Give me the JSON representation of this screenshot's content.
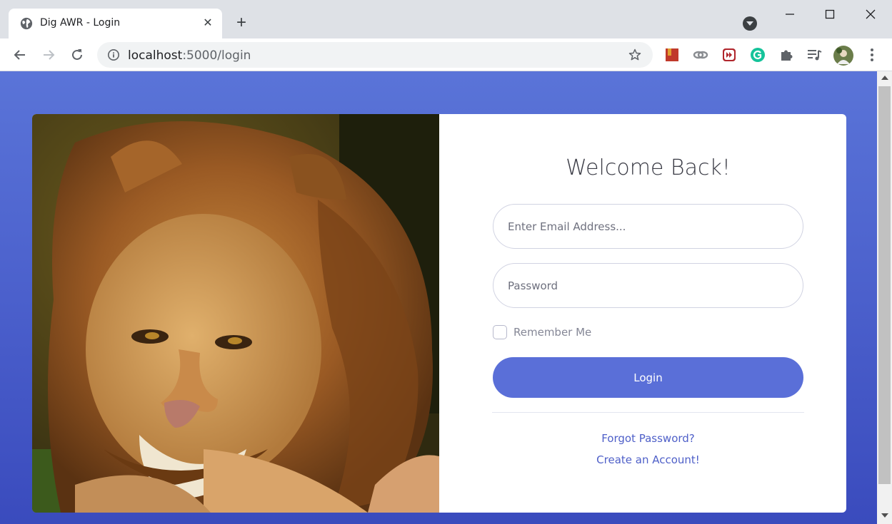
{
  "browser": {
    "tab": {
      "title": "Dig AWR - Login",
      "favicon": "globe-icon"
    },
    "address_bar": {
      "host": "localhost",
      "path": ":5000/login"
    },
    "extensions": [
      "bookmark-extension-icon",
      "link-extension-icon",
      "media-extension-icon",
      "grammarly-icon",
      "puzzle-icon",
      "reading-list-icon"
    ]
  },
  "page": {
    "heading": "Welcome Back!",
    "email_placeholder": "Enter Email Address...",
    "password_placeholder": "Password",
    "remember_label": "Remember Me",
    "login_label": "Login",
    "forgot_link": "Forgot Password?",
    "create_link": "Create an Account!"
  },
  "colors": {
    "background": "#4e62cd",
    "button": "#5a6fd8",
    "link": "#4e5fc8"
  }
}
